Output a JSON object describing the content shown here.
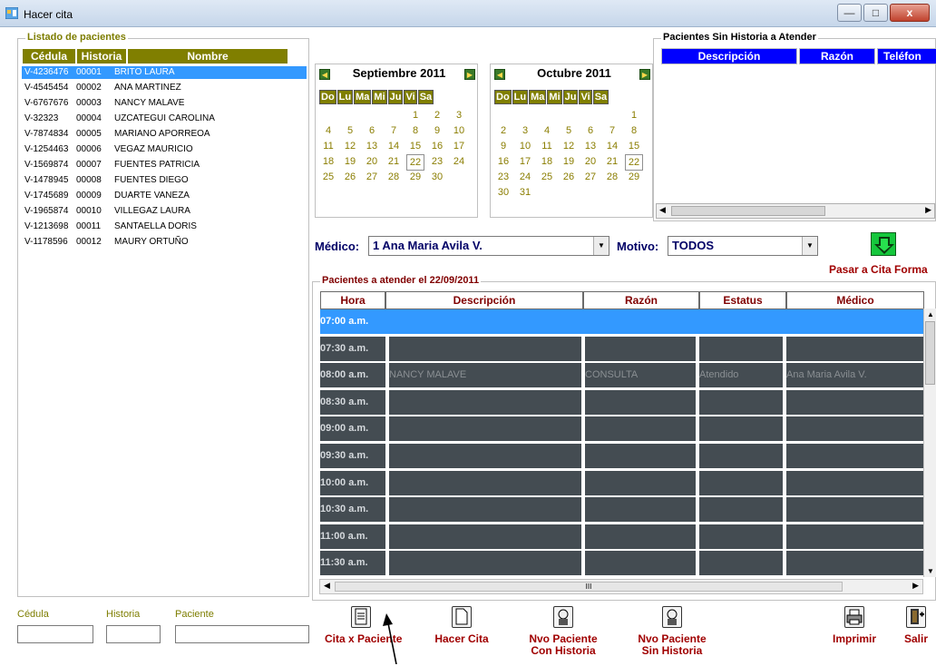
{
  "window": {
    "title": "Hacer cita",
    "minimize": "—",
    "maximize": "□",
    "close": "x"
  },
  "patients": {
    "legend": "Listado de pacientes",
    "columns": [
      "Cédula",
      "Historia",
      "Nombre"
    ],
    "rows": [
      {
        "cedula": "V-4236476",
        "historia": "00001",
        "nombre": "BRITO LAURA",
        "selected": true
      },
      {
        "cedula": "V-4545454",
        "historia": "00002",
        "nombre": "ANA MARTINEZ"
      },
      {
        "cedula": "V-6767676",
        "historia": "00003",
        "nombre": "NANCY MALAVE"
      },
      {
        "cedula": "V-32323",
        "historia": "00004",
        "nombre": "UZCATEGUI CAROLINA"
      },
      {
        "cedula": "V-7874834",
        "historia": "00005",
        "nombre": "MARIANO APORREOA"
      },
      {
        "cedula": "V-1254463",
        "historia": "00006",
        "nombre": "VEGAZ MAURICIO"
      },
      {
        "cedula": "V-1569874",
        "historia": "00007",
        "nombre": "FUENTES PATRICIA"
      },
      {
        "cedula": "V-1478945",
        "historia": "00008",
        "nombre": "FUENTES DIEGO"
      },
      {
        "cedula": "V-1745689",
        "historia": "00009",
        "nombre": "DUARTE VANEZA"
      },
      {
        "cedula": "V-1965874",
        "historia": "00010",
        "nombre": "VILLEGAZ LAURA"
      },
      {
        "cedula": "V-1213698",
        "historia": "00011",
        "nombre": "SANTAELLA DORIS"
      },
      {
        "cedula": "V-1178596",
        "historia": "00012",
        "nombre": "MAURY ORTUÑO"
      }
    ]
  },
  "search": {
    "cedula_label": "Cédula",
    "historia_label": "Historia",
    "paciente_label": "Paciente",
    "cedula_value": "",
    "historia_value": "",
    "paciente_value": ""
  },
  "calendars": [
    {
      "month": "Septiembre 2011",
      "weekdays": [
        "Do",
        "Lu",
        "Ma",
        "Mi",
        "Ju",
        "Vi",
        "Sa"
      ],
      "weeks": [
        [
          "",
          "",
          "",
          "",
          "1",
          "2",
          "3"
        ],
        [
          "4",
          "5",
          "6",
          "7",
          "8",
          "9",
          "10"
        ],
        [
          "11",
          "12",
          "13",
          "14",
          "15",
          "16",
          "17"
        ],
        [
          "18",
          "19",
          "20",
          "21",
          "22",
          "23",
          "24"
        ],
        [
          "25",
          "26",
          "27",
          "28",
          "29",
          "30",
          ""
        ]
      ],
      "today": "22"
    },
    {
      "month": "Octubre 2011",
      "weekdays": [
        "Do",
        "Lu",
        "Ma",
        "Mi",
        "Ju",
        "Vi",
        "Sa"
      ],
      "weeks": [
        [
          "",
          "",
          "",
          "",
          "",
          "",
          "1"
        ],
        [
          "2",
          "3",
          "4",
          "5",
          "6",
          "7",
          "8"
        ],
        [
          "9",
          "10",
          "11",
          "12",
          "13",
          "14",
          "15"
        ],
        [
          "16",
          "17",
          "18",
          "19",
          "20",
          "21",
          "22"
        ],
        [
          "23",
          "24",
          "25",
          "26",
          "27",
          "28",
          "29"
        ],
        [
          "30",
          "31",
          "",
          "",
          "",
          "",
          ""
        ]
      ],
      "today": "22"
    }
  ],
  "sin_historia": {
    "legend": "Pacientes Sin Historia a Atender",
    "columns": [
      "Descripción",
      "Razón",
      "Teléfon"
    ]
  },
  "filters": {
    "medico_label": "Médico:",
    "medico_value": "1 Ana Maria Avila V.",
    "motivo_label": "Motivo:",
    "motivo_value": "TODOS",
    "pasar_label": "Pasar a Cita Forma"
  },
  "schedule": {
    "legend": "Pacientes a atender el 22/09/2011",
    "columns": [
      "Hora",
      "Descripción",
      "Razón",
      "Estatus",
      "Médico"
    ],
    "rows": [
      {
        "hora": "07:00 a.m.",
        "descripcion": "",
        "razon": "",
        "estatus": "",
        "medico": "",
        "selected": true
      },
      {
        "hora": "07:30 a.m.",
        "descripcion": "",
        "razon": "",
        "estatus": "",
        "medico": ""
      },
      {
        "hora": "08:00 a.m.",
        "descripcion": "NANCY MALAVE",
        "razon": "CONSULTA",
        "estatus": "Atendido",
        "medico": "Ana Maria Avila V."
      },
      {
        "hora": "08:30 a.m.",
        "descripcion": "",
        "razon": "",
        "estatus": "",
        "medico": ""
      },
      {
        "hora": "09:00 a.m.",
        "descripcion": "",
        "razon": "",
        "estatus": "",
        "medico": ""
      },
      {
        "hora": "09:30 a.m.",
        "descripcion": "",
        "razon": "",
        "estatus": "",
        "medico": ""
      },
      {
        "hora": "10:00 a.m.",
        "descripcion": "",
        "razon": "",
        "estatus": "",
        "medico": ""
      },
      {
        "hora": "10:30 a.m.",
        "descripcion": "",
        "razon": "",
        "estatus": "",
        "medico": ""
      },
      {
        "hora": "11:00 a.m.",
        "descripcion": "",
        "razon": "",
        "estatus": "",
        "medico": ""
      },
      {
        "hora": "11:30 a.m.",
        "descripcion": "",
        "razon": "",
        "estatus": "",
        "medico": ""
      }
    ],
    "hscroll_grip": "III"
  },
  "toolbar": {
    "cita_x_paciente": "Cita x Paciente",
    "hacer_cita": "Hacer Cita",
    "nvo_con_historia_1": "Nvo Paciente",
    "nvo_con_historia_2": "Con Historia",
    "nvo_sin_historia_1": "Nvo Paciente",
    "nvo_sin_historia_2": "Sin Historia",
    "imprimir": "Imprimir",
    "salir": "Salir"
  },
  "colors": {
    "olive_header": "#807f00",
    "selection_blue": "#3399ff",
    "grid_dark": "#444c52",
    "accent_red": "#a00000",
    "sin_historia_header": "#0000ff"
  }
}
